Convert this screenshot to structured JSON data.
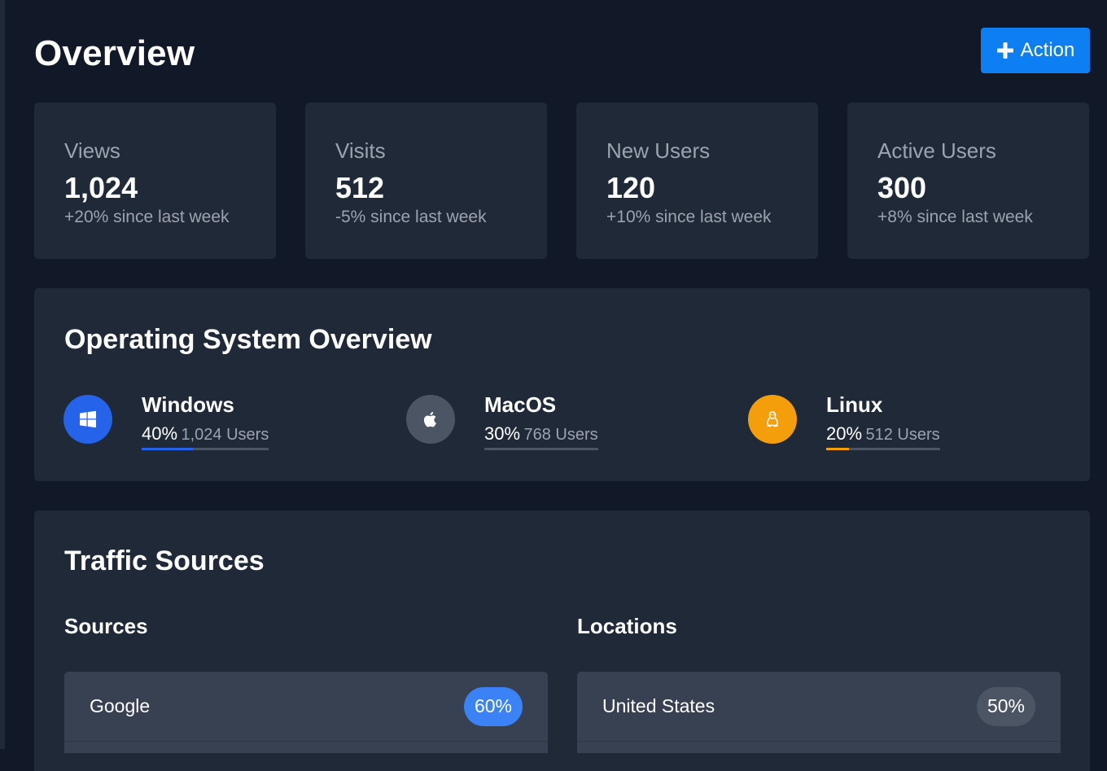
{
  "page": {
    "title": "Overview"
  },
  "header": {
    "action_label": "Action"
  },
  "stats": [
    {
      "label": "Views",
      "value": "1,024",
      "change": "+20% since last week"
    },
    {
      "label": "Visits",
      "value": "512",
      "change": "-5% since last week"
    },
    {
      "label": "New Users",
      "value": "120",
      "change": "+10% since last week"
    },
    {
      "label": "Active Users",
      "value": "300",
      "change": "+8% since last week"
    }
  ],
  "os_overview": {
    "title": "Operating System Overview",
    "items": [
      {
        "name": "Windows",
        "percent": "40%",
        "users": "1,024 Users",
        "share": 0.4,
        "color": "#2563eb",
        "icon": "windows-icon"
      },
      {
        "name": "MacOS",
        "percent": "30%",
        "users": "768 Users",
        "share": 0.3,
        "color": "#4b5563",
        "icon": "apple-icon"
      },
      {
        "name": "Linux",
        "percent": "20%",
        "users": "512 Users",
        "share": 0.2,
        "color": "#f59e0b",
        "icon": "linux-icon"
      }
    ]
  },
  "traffic": {
    "title": "Traffic Sources",
    "sources": {
      "heading": "Sources",
      "rows": [
        {
          "label": "Google",
          "badge": "60%",
          "badge_color": "#3b82f6"
        }
      ]
    },
    "locations": {
      "heading": "Locations",
      "rows": [
        {
          "label": "United States",
          "badge": "50%",
          "badge_color": "#4b5563"
        }
      ]
    }
  }
}
